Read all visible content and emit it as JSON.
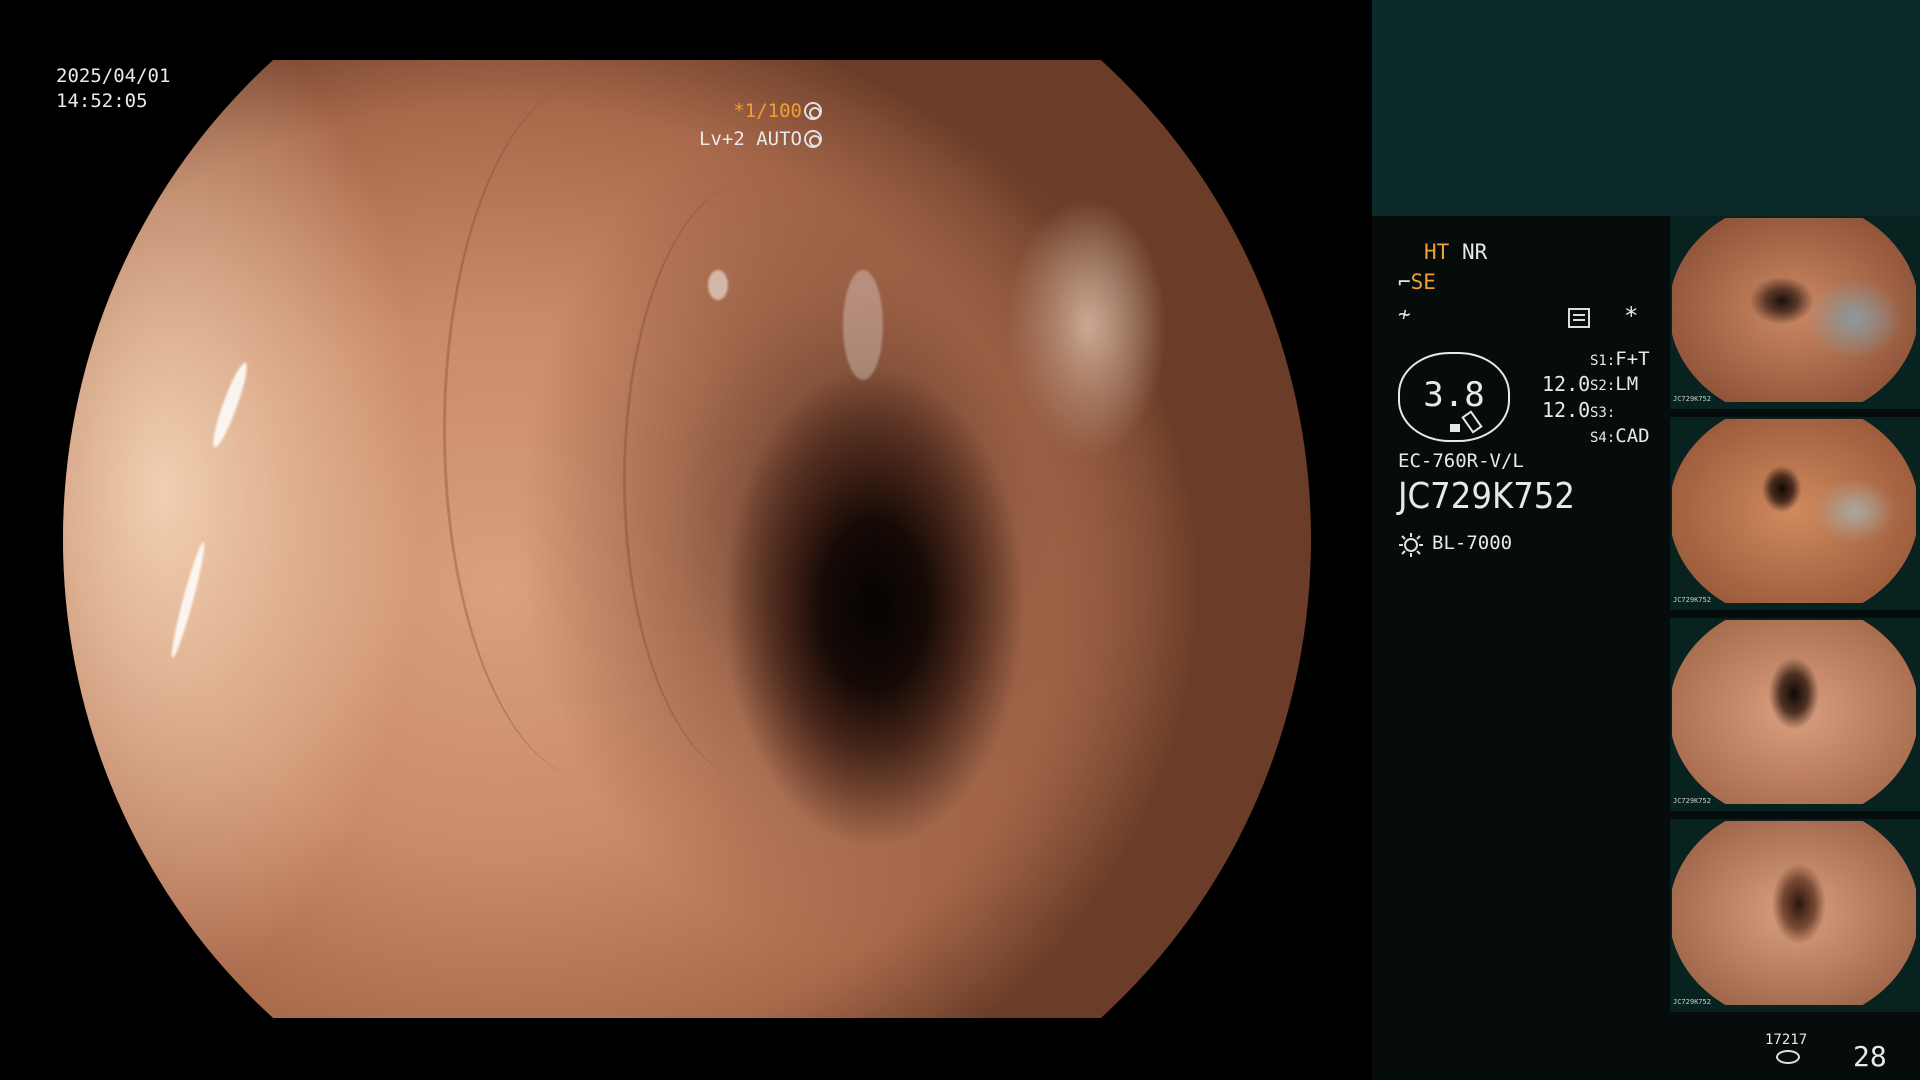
{
  "osd": {
    "date": "2025/04/01",
    "time": "14:52:05",
    "shutter": "*1/100",
    "level": "Lv+2 AUTO"
  },
  "side_panel": {
    "mode_ht": "HT",
    "mode_nr": "NR",
    "mode_se": "SE",
    "zoom": "3.8",
    "value_1": "12.0",
    "value_2": "12.0",
    "s1_label": "S1:",
    "s1_value": "F+T",
    "s2_label": "S2:",
    "s2_value": "LM",
    "s3_label": "S3:",
    "s3_value": "",
    "s4_label": "S4:",
    "s4_value": "CAD",
    "scope_model": "EC-760R-V/L",
    "serial": "JC729K752",
    "light_source": "BL-7000",
    "star": "*"
  },
  "thumbnails": [
    {
      "label": "JC729K752"
    },
    {
      "label": "JC729K752"
    },
    {
      "label": "JC729K752"
    },
    {
      "label": "JC729K752"
    }
  ],
  "footer": {
    "storage_count": "17217",
    "image_count": "28"
  },
  "colors": {
    "accent_orange": "#f0a030",
    "panel_top": "#0c2a2a",
    "panel_bg": "#060c0c"
  }
}
